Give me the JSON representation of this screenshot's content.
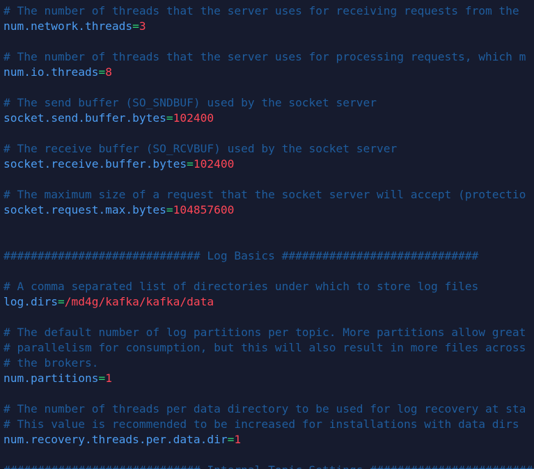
{
  "colors": {
    "background": "#161b2e",
    "comment": "#1f5d9e",
    "key": "#4d9df2",
    "equals": "#2ecc71",
    "value": "#ff4757"
  },
  "lines": [
    {
      "type": "comment",
      "text": "# The number of threads that the server uses for receiving requests from the"
    },
    {
      "type": "kv",
      "key": "num.network.threads",
      "eq": "=",
      "value": "3"
    },
    {
      "type": "blank"
    },
    {
      "type": "comment",
      "text": "# The number of threads that the server uses for processing requests, which m"
    },
    {
      "type": "kv",
      "key": "num.io.threads",
      "eq": "=",
      "value": "8"
    },
    {
      "type": "blank"
    },
    {
      "type": "comment",
      "text": "# The send buffer (SO_SNDBUF) used by the socket server"
    },
    {
      "type": "kv",
      "key": "socket.send.buffer.bytes",
      "eq": "=",
      "value": "102400"
    },
    {
      "type": "blank"
    },
    {
      "type": "comment",
      "text": "# The receive buffer (SO_RCVBUF) used by the socket server"
    },
    {
      "type": "kv",
      "key": "socket.receive.buffer.bytes",
      "eq": "=",
      "value": "102400"
    },
    {
      "type": "blank"
    },
    {
      "type": "comment",
      "text": "# The maximum size of a request that the socket server will accept (protectio"
    },
    {
      "type": "kv",
      "key": "socket.request.max.bytes",
      "eq": "=",
      "value": "104857600"
    },
    {
      "type": "blank"
    },
    {
      "type": "blank"
    },
    {
      "type": "comment",
      "text": "############################# Log Basics #############################"
    },
    {
      "type": "blank"
    },
    {
      "type": "comment",
      "text": "# A comma separated list of directories under which to store log files"
    },
    {
      "type": "kv",
      "key": "log.dirs",
      "eq": "=",
      "value": "/md4g/kafka/kafka/data"
    },
    {
      "type": "blank"
    },
    {
      "type": "comment",
      "text": "# The default number of log partitions per topic. More partitions allow great"
    },
    {
      "type": "comment",
      "text": "# parallelism for consumption, but this will also result in more files across"
    },
    {
      "type": "comment",
      "text": "# the brokers."
    },
    {
      "type": "kv",
      "key": "num.partitions",
      "eq": "=",
      "value": "1"
    },
    {
      "type": "blank"
    },
    {
      "type": "comment",
      "text": "# The number of threads per data directory to be used for log recovery at sta"
    },
    {
      "type": "comment",
      "text": "# This value is recommended to be increased for installations with data dirs"
    },
    {
      "type": "kv",
      "key": "num.recovery.threads.per.data.dir",
      "eq": "=",
      "value": "1"
    },
    {
      "type": "blank"
    },
    {
      "type": "comment",
      "text": "############################# Internal Topic Settings #############################"
    }
  ]
}
